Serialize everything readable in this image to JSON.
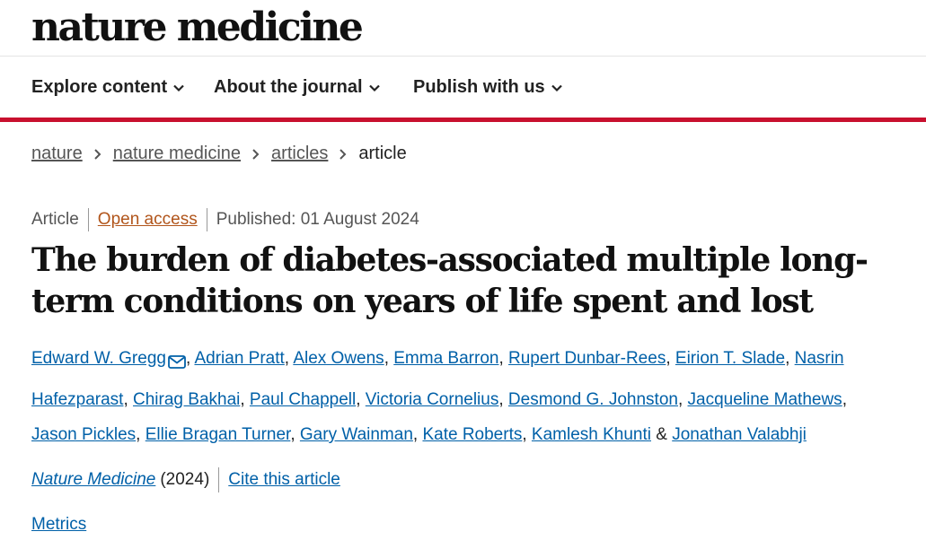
{
  "logo": "nature medicine",
  "nav": [
    {
      "label": "Explore content"
    },
    {
      "label": "About the journal"
    },
    {
      "label": "Publish with us"
    }
  ],
  "breadcrumb": [
    "nature",
    "nature medicine",
    "articles",
    "article"
  ],
  "meta": {
    "type": "Article",
    "access": "Open access",
    "published": "Published: 01 August 2024"
  },
  "title": "The burden of diabetes-associated multiple long-term conditions on years of life spent and lost",
  "authors": [
    "Edward W. Gregg",
    "Adrian Pratt",
    "Alex Owens",
    "Emma Barron",
    "Rupert Dunbar-Rees",
    "Eirion T. Slade",
    "Nasrin Hafezparast",
    "Chirag Bakhai",
    "Paul Chappell",
    "Victoria Cornelius",
    "Desmond G. Johnston",
    "Jacqueline Mathews",
    "Jason Pickles",
    "Ellie Bragan Turner",
    "Gary Wainman",
    "Kate Roberts",
    "Kamlesh Khunti",
    "Jonathan Valabhji"
  ],
  "journal": {
    "name": "Nature Medicine",
    "year": "(2024)",
    "cite": "Cite this article"
  },
  "metrics": "Metrics"
}
